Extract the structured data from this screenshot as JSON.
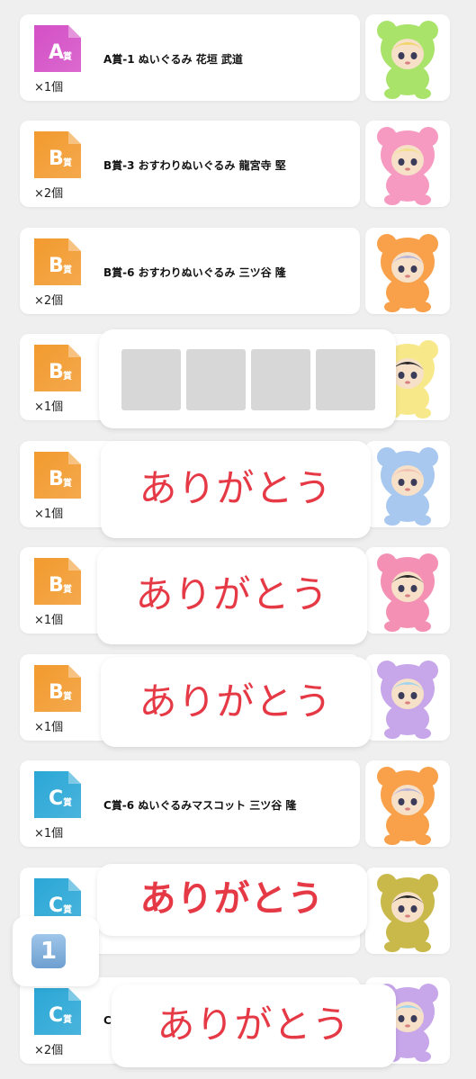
{
  "items": [
    {
      "grade": "A",
      "grade_label": "賞",
      "badge_color": "#d44fc6",
      "qty": "×1個",
      "title": "A賞-1 ぬいぐるみ 花垣 武道",
      "plush_color": "#a9e36a",
      "face": "#f6e0c8",
      "hair": "#f0d46a"
    },
    {
      "grade": "B",
      "grade_label": "賞",
      "badge_color": "#f29a2e",
      "qty": "×2個",
      "title": "B賞-3 おすわりぬいぐるみ 龍宮寺 堅",
      "plush_color": "#f79ac1",
      "face": "#f6e0c8",
      "hair": "#f2e08c"
    },
    {
      "grade": "B",
      "grade_label": "賞",
      "badge_color": "#f29a2e",
      "qty": "×2個",
      "title": "B賞-6 おすわりぬいぐるみ 三ツ谷 隆",
      "plush_color": "#f9a04a",
      "face": "#f6e0c8",
      "hair": "#b9b4d6"
    },
    {
      "grade": "B",
      "grade_label": "賞",
      "badge_color": "#f29a2e",
      "qty": "×1個",
      "title": "",
      "plush_color": "#f7e98a",
      "face": "#f6e0c8",
      "hair": "#2b2b2b"
    },
    {
      "grade": "B",
      "grade_label": "賞",
      "badge_color": "#f29a2e",
      "qty": "×1個",
      "title": "",
      "plush_color": "#a8c8ef",
      "face": "#f6e0c8",
      "hair": "#f2c2b0"
    },
    {
      "grade": "B",
      "grade_label": "賞",
      "badge_color": "#f29a2e",
      "qty": "×1個",
      "title": "",
      "plush_color": "#f490b4",
      "face": "#f6e0c8",
      "hair": "#2b2b2b"
    },
    {
      "grade": "B",
      "grade_label": "賞",
      "badge_color": "#f29a2e",
      "qty": "×1個",
      "title": "",
      "plush_color": "#c7a6ea",
      "face": "#f6e0c8",
      "hair": "#9fd4f0"
    },
    {
      "grade": "C",
      "grade_label": "賞",
      "badge_color": "#2aa7d6",
      "qty": "×1個",
      "title": "C賞-6 ぬいぐるみマスコット 三ツ谷 隆",
      "plush_color": "#f9a04a",
      "face": "#f6e0c8",
      "hair": "#b9b4d6"
    },
    {
      "grade": "C",
      "grade_label": "賞",
      "badge_color": "#2aa7d6",
      "qty": "",
      "title": "",
      "plush_color": "#c9b84a",
      "face": "#f6e0c8",
      "hair": "#2b2b2b"
    },
    {
      "grade": "C",
      "grade_label": "賞",
      "badge_color": "#2aa7d6",
      "qty": "×2個",
      "title": "C",
      "plush_color": "#c7a6ea",
      "face": "#f6e0c8",
      "hair": "#9fd4f0"
    }
  ],
  "overlays": {
    "thanks_text": "ありがとう",
    "keycap_number": "1"
  }
}
